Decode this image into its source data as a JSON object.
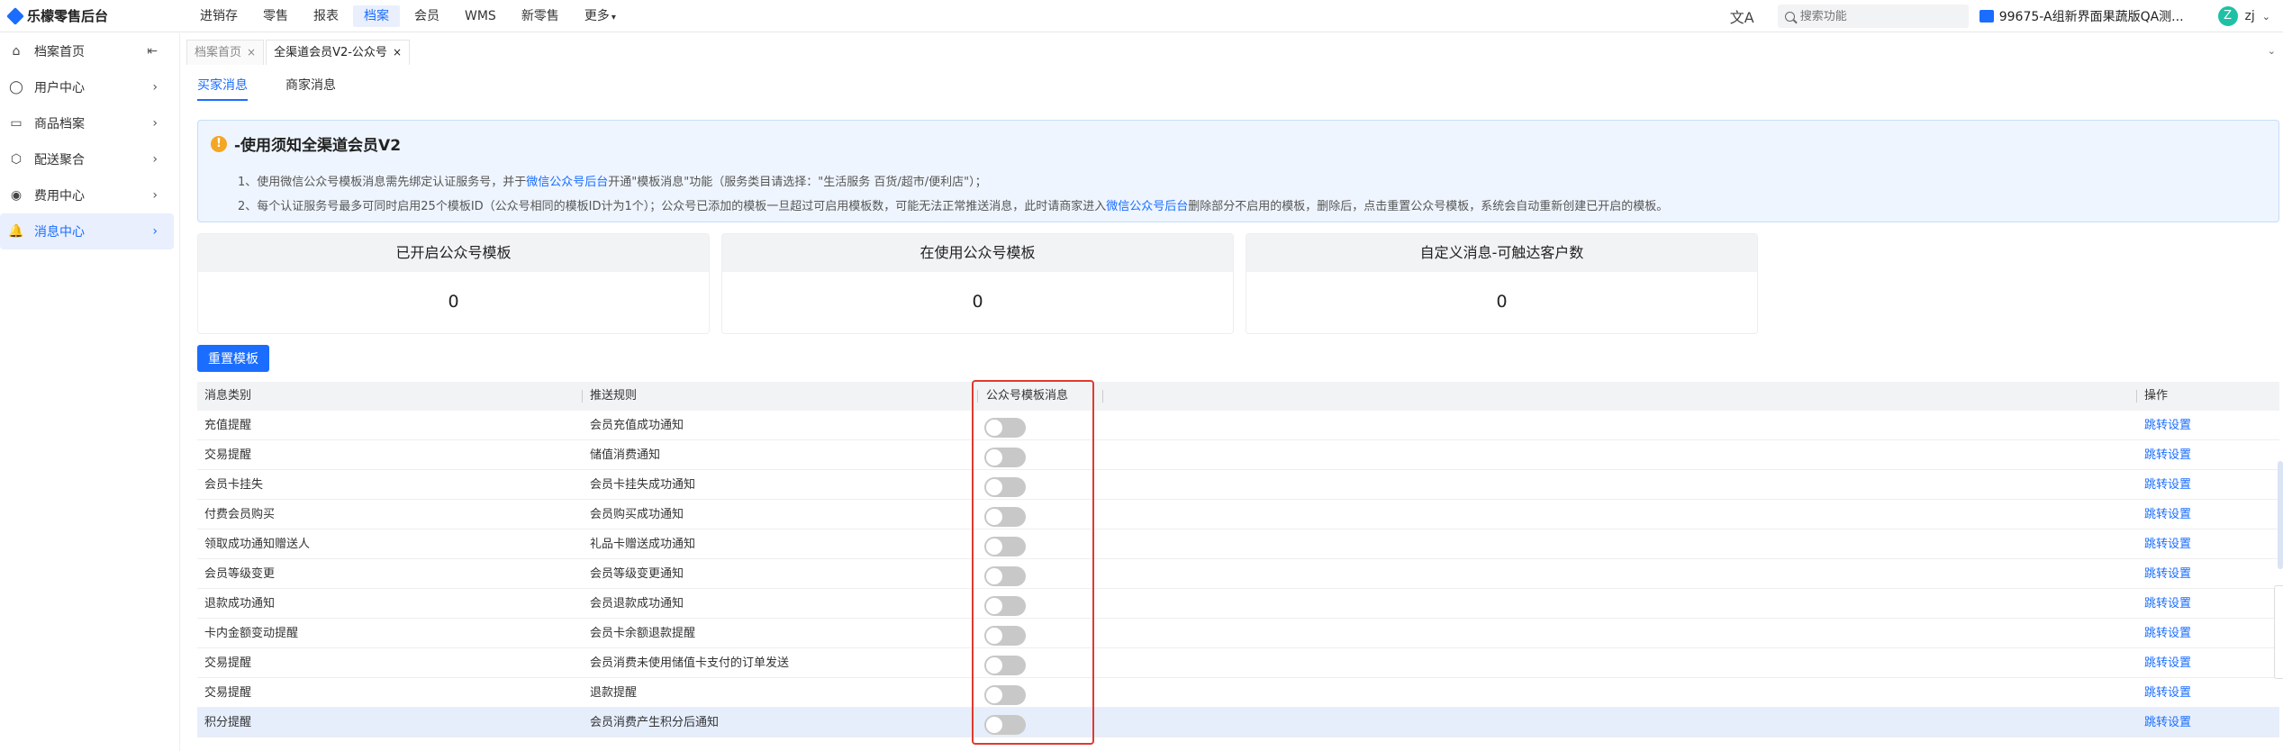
{
  "app": {
    "title": "乐檬零售后台"
  },
  "topnav": [
    {
      "label": "进销存",
      "active": false
    },
    {
      "label": "零售",
      "active": false
    },
    {
      "label": "报表",
      "active": false
    },
    {
      "label": "档案",
      "active": true
    },
    {
      "label": "会员",
      "active": false
    },
    {
      "label": "WMS",
      "active": false
    },
    {
      "label": "新零售",
      "active": false
    },
    {
      "label": "更多",
      "active": false,
      "caret": "▾"
    }
  ],
  "search": {
    "placeholder": "搜索功能"
  },
  "store": {
    "name": "99675-A组新界面果蔬版QA测..."
  },
  "user": {
    "avatar": "Z",
    "name": "zj",
    "caret": "⌄"
  },
  "sidebar": {
    "items": [
      {
        "label": "档案首页",
        "icon": "⌂",
        "arrow": "⇤",
        "active": false
      },
      {
        "label": "用户中心",
        "icon": "◯",
        "arrow": "›",
        "active": false
      },
      {
        "label": "商品档案",
        "icon": "▭",
        "arrow": "›",
        "active": false
      },
      {
        "label": "配送聚合",
        "icon": "⬡",
        "arrow": "›",
        "active": false
      },
      {
        "label": "费用中心",
        "icon": "◉",
        "arrow": "›",
        "active": false
      },
      {
        "label": "消息中心",
        "icon": "🔔",
        "arrow": "›",
        "active": true
      }
    ]
  },
  "pagetabs": [
    {
      "label": "档案首页",
      "close": "×",
      "active": false
    },
    {
      "label": "全渠道会员V2-公众号",
      "close": "×",
      "active": true
    }
  ],
  "subtabs": [
    {
      "label": "买家消息",
      "active": true
    },
    {
      "label": "商家消息",
      "active": false
    }
  ],
  "notice": {
    "icon": "!",
    "title": "-使用须知全渠道会员V2",
    "line1_a": "1、使用微信公众号模板消息需先绑定认证服务号，并于",
    "line1_link": "微信公众号后台",
    "line1_b": "开通\"模板消息\"功能（服务类目请选择：\"生活服务 百货/超市/便利店\"）；",
    "line2_a": "2、每个认证服务号最多可同时启用25个模板ID（公众号相同的模板ID计为1个）；公众号已添加的模板一旦超过可启用模板数，可能无法正常推送消息，此时请商家进入",
    "line2_link": "微信公众号后台",
    "line2_b": "删除部分不启用的模板，删除后，点击重置公众号模板，系统会自动重新创建已开启的模板。"
  },
  "stats": [
    {
      "label": "已开启公众号模板",
      "value": "0"
    },
    {
      "label": "在使用公众号模板",
      "value": "0"
    },
    {
      "label": "自定义消息-可触达客户数",
      "value": "0"
    }
  ],
  "reset_button": "重置模板",
  "table": {
    "headers": [
      "消息类别",
      "推送规则",
      "公众号模板消息",
      "操作"
    ],
    "action_label": "跳转设置",
    "rows": [
      {
        "category": "充值提醒",
        "rule": "会员充值成功通知",
        "enabled": false
      },
      {
        "category": "交易提醒",
        "rule": "储值消费通知",
        "enabled": false
      },
      {
        "category": "会员卡挂失",
        "rule": "会员卡挂失成功通知",
        "enabled": false
      },
      {
        "category": "付费会员购买",
        "rule": "会员购买成功通知",
        "enabled": false
      },
      {
        "category": "领取成功通知赠送人",
        "rule": "礼品卡赠送成功通知",
        "enabled": false
      },
      {
        "category": "会员等级变更",
        "rule": "会员等级变更通知",
        "enabled": false
      },
      {
        "category": "退款成功通知",
        "rule": "会员退款成功通知",
        "enabled": false
      },
      {
        "category": "卡内金额变动提醒",
        "rule": "会员卡余额退款提醒",
        "enabled": false
      },
      {
        "category": "交易提醒",
        "rule": "会员消费未使用储值卡支付的订单发送",
        "enabled": false
      },
      {
        "category": "交易提醒",
        "rule": "退款提醒",
        "enabled": false
      },
      {
        "category": "积分提醒",
        "rule": "会员消费产生积分后通知",
        "enabled": false
      }
    ]
  },
  "colors": {
    "accent": "#1a6dff",
    "highlight_box": "#e03a2f",
    "warning": "#f5a623"
  }
}
